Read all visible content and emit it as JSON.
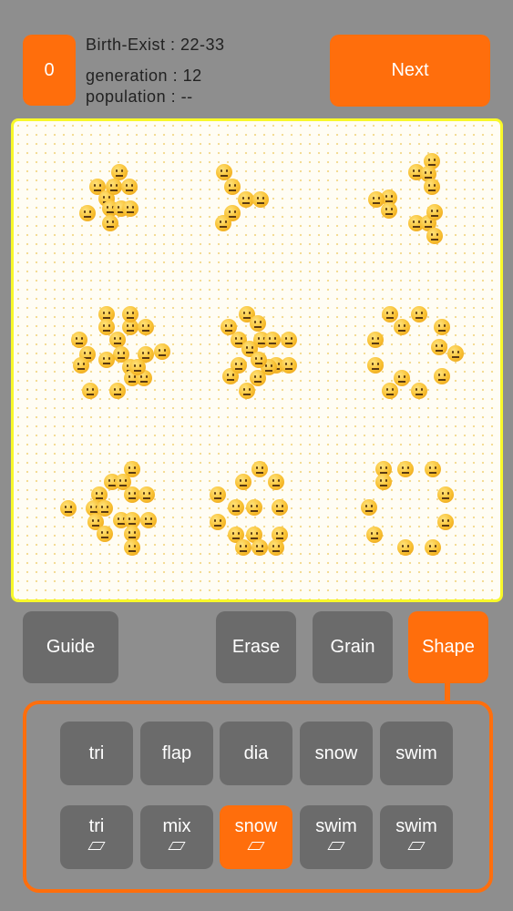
{
  "header": {
    "counter": "0",
    "birth_exist": "Birth-Exist : 22-33",
    "generation": "generation : 12",
    "population": "population : --",
    "next_label": "Next"
  },
  "toolbar": {
    "guide": "Guide",
    "erase": "Erase",
    "grain": "Grain",
    "shape": "Shape"
  },
  "shapes": {
    "row1": [
      "tri",
      "flap",
      "dia",
      "snow",
      "swim"
    ],
    "row2": [
      "tri",
      "mix",
      "snow",
      "swim",
      "swim"
    ],
    "selected": "row2-snow",
    "row2_icon": "parallelogram-icon"
  },
  "colors": {
    "accent": "#ff6e0c",
    "button": "#6b6b6b",
    "background": "#8e8e8e",
    "board_border": "#f8f82a",
    "cell": "#f8bf30"
  },
  "board": {
    "cell_icon": "neutral-face-icon",
    "live_cells": 124
  }
}
